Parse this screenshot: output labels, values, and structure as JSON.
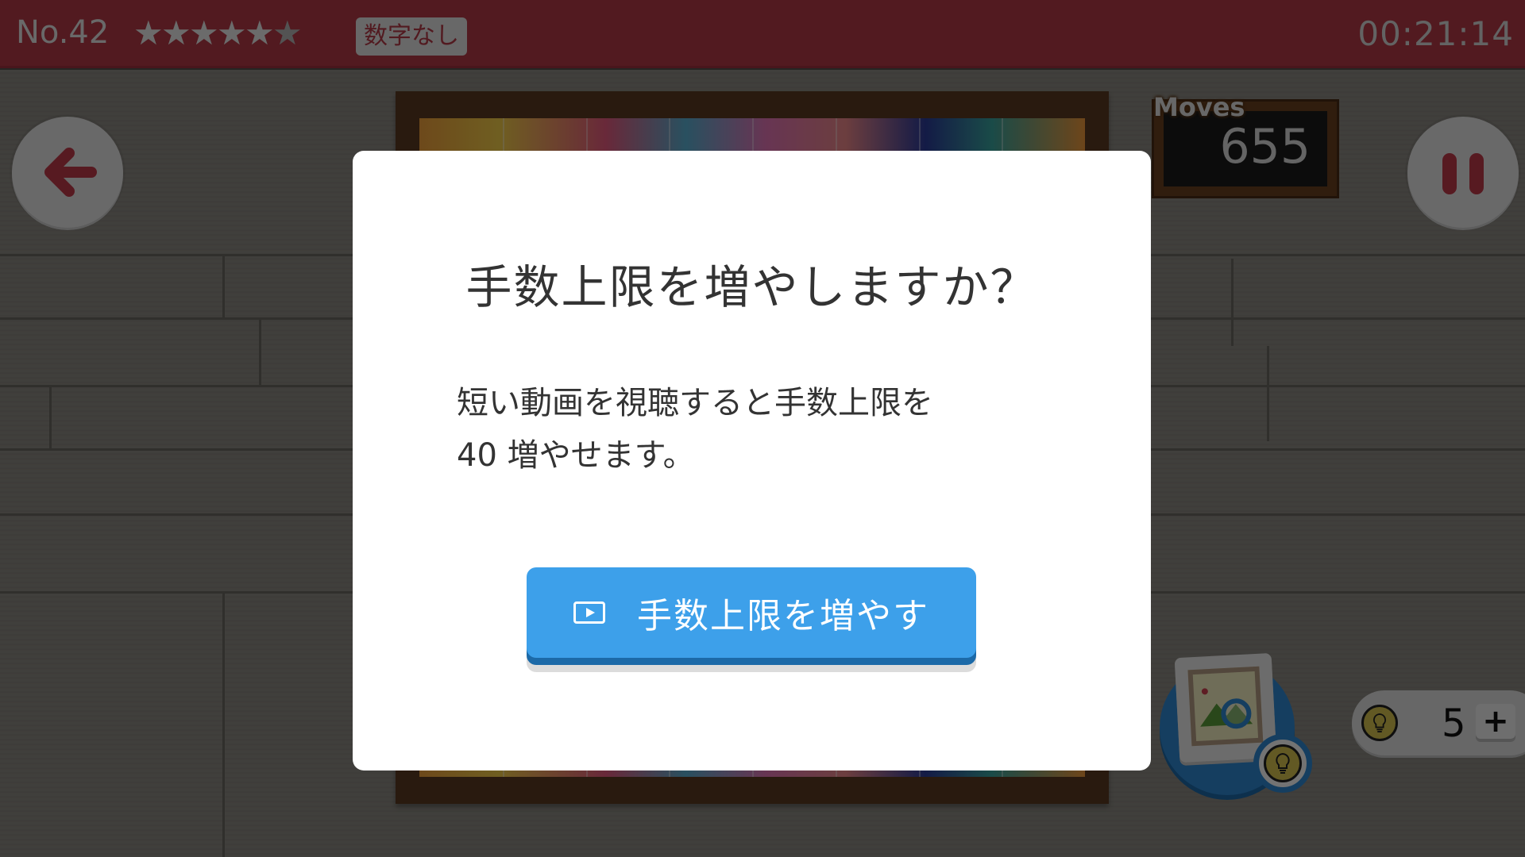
{
  "header": {
    "level": "No.42",
    "difficulty_stars": 6,
    "difficulty_filled": 5,
    "mode_badge": "数字なし",
    "timer": "00:21:14"
  },
  "colors": {
    "header_bg": "#b53a48",
    "accent_red": "#c03a4b",
    "button_blue": "#3da0ea",
    "button_blue_shadow": "#1c6aa8"
  },
  "moves": {
    "label": "Moves",
    "value": "655"
  },
  "controls": {
    "back_icon": "arrow-left-icon",
    "pause_icon": "pause-icon",
    "preview_icon": "image-magnifier-icon",
    "hint_icon": "lightbulb-coin-icon"
  },
  "hints": {
    "count": "5",
    "add_label": "+"
  },
  "dialog": {
    "title": "手数上限を増やしますか？",
    "body_line1": "短い動画を視聴すると手数上限を",
    "body_line2": "40 増やせます。",
    "button_label": "手数上限を増やす",
    "button_icon": "video-play-icon"
  }
}
